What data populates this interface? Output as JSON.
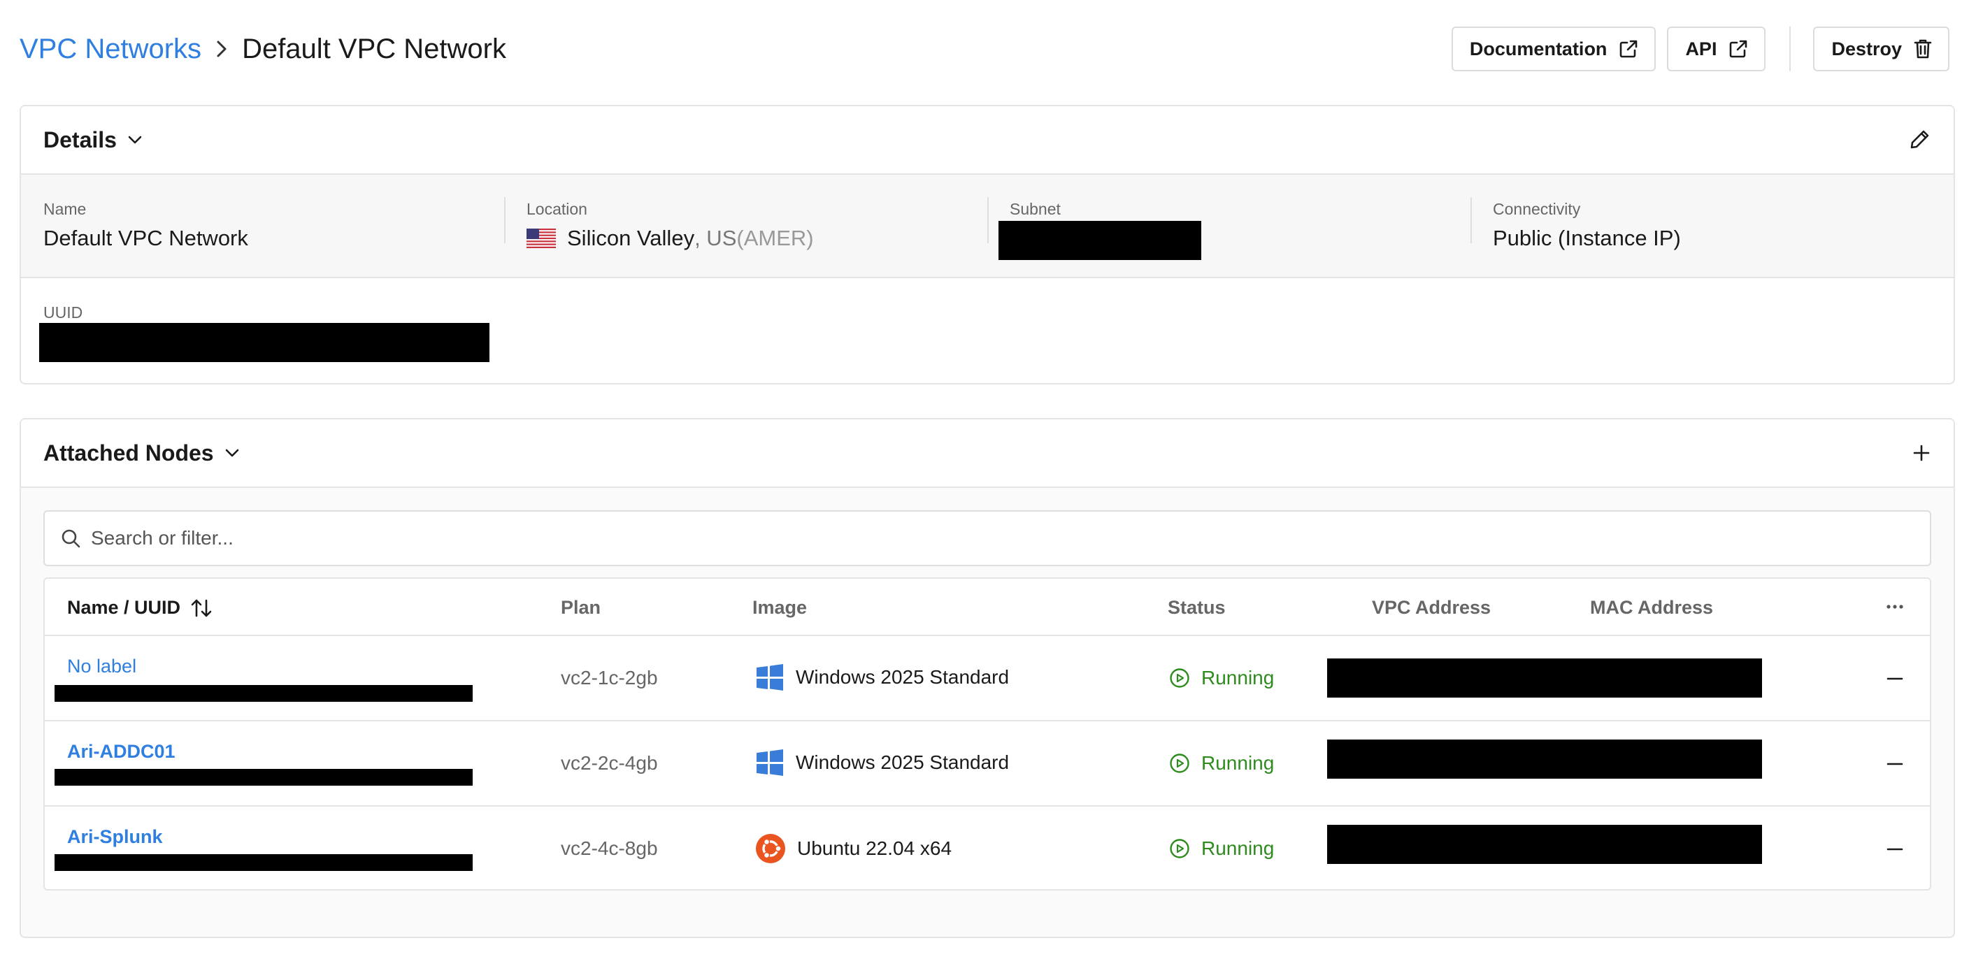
{
  "breadcrumb": {
    "parent": "VPC Networks",
    "current": "Default VPC Network"
  },
  "header_actions": {
    "documentation": "Documentation",
    "api": "API",
    "destroy": "Destroy"
  },
  "details": {
    "title": "Details",
    "name": {
      "label": "Name",
      "value": "Default VPC Network"
    },
    "location": {
      "label": "Location",
      "city": "Silicon Valley",
      "country": ", US",
      "region": " (AMER)",
      "flag": "us-flag"
    },
    "subnet": {
      "label": "Subnet"
    },
    "connectivity": {
      "label": "Connectivity",
      "value": "Public (Instance IP)"
    },
    "uuid": {
      "label": "UUID"
    }
  },
  "nodes": {
    "title": "Attached Nodes",
    "search_placeholder": "Search or filter...",
    "columns": {
      "name": "Name / UUID",
      "plan": "Plan",
      "image": "Image",
      "status": "Status",
      "vpc": "VPC Address",
      "mac": "MAC Address"
    },
    "rows": [
      {
        "label": "No label",
        "plan": "vc2-1c-2gb",
        "image": "Windows 2025 Standard",
        "os_icon": "windows-icon",
        "status": "Running"
      },
      {
        "label": "Ari-ADDC01",
        "plan": "vc2-2c-4gb",
        "image": "Windows 2025 Standard",
        "os_icon": "windows-icon",
        "status": "Running"
      },
      {
        "label": "Ari-Splunk",
        "plan": "vc2-4c-8gb",
        "image": "Ubuntu 22.04 x64",
        "os_icon": "ubuntu-icon",
        "status": "Running"
      }
    ]
  },
  "colors": {
    "link": "#2f7fe0",
    "running": "#2e8b1e",
    "border": "#e4e4e4",
    "windows": "#3a7dd8",
    "ubuntu": "#e95420"
  }
}
